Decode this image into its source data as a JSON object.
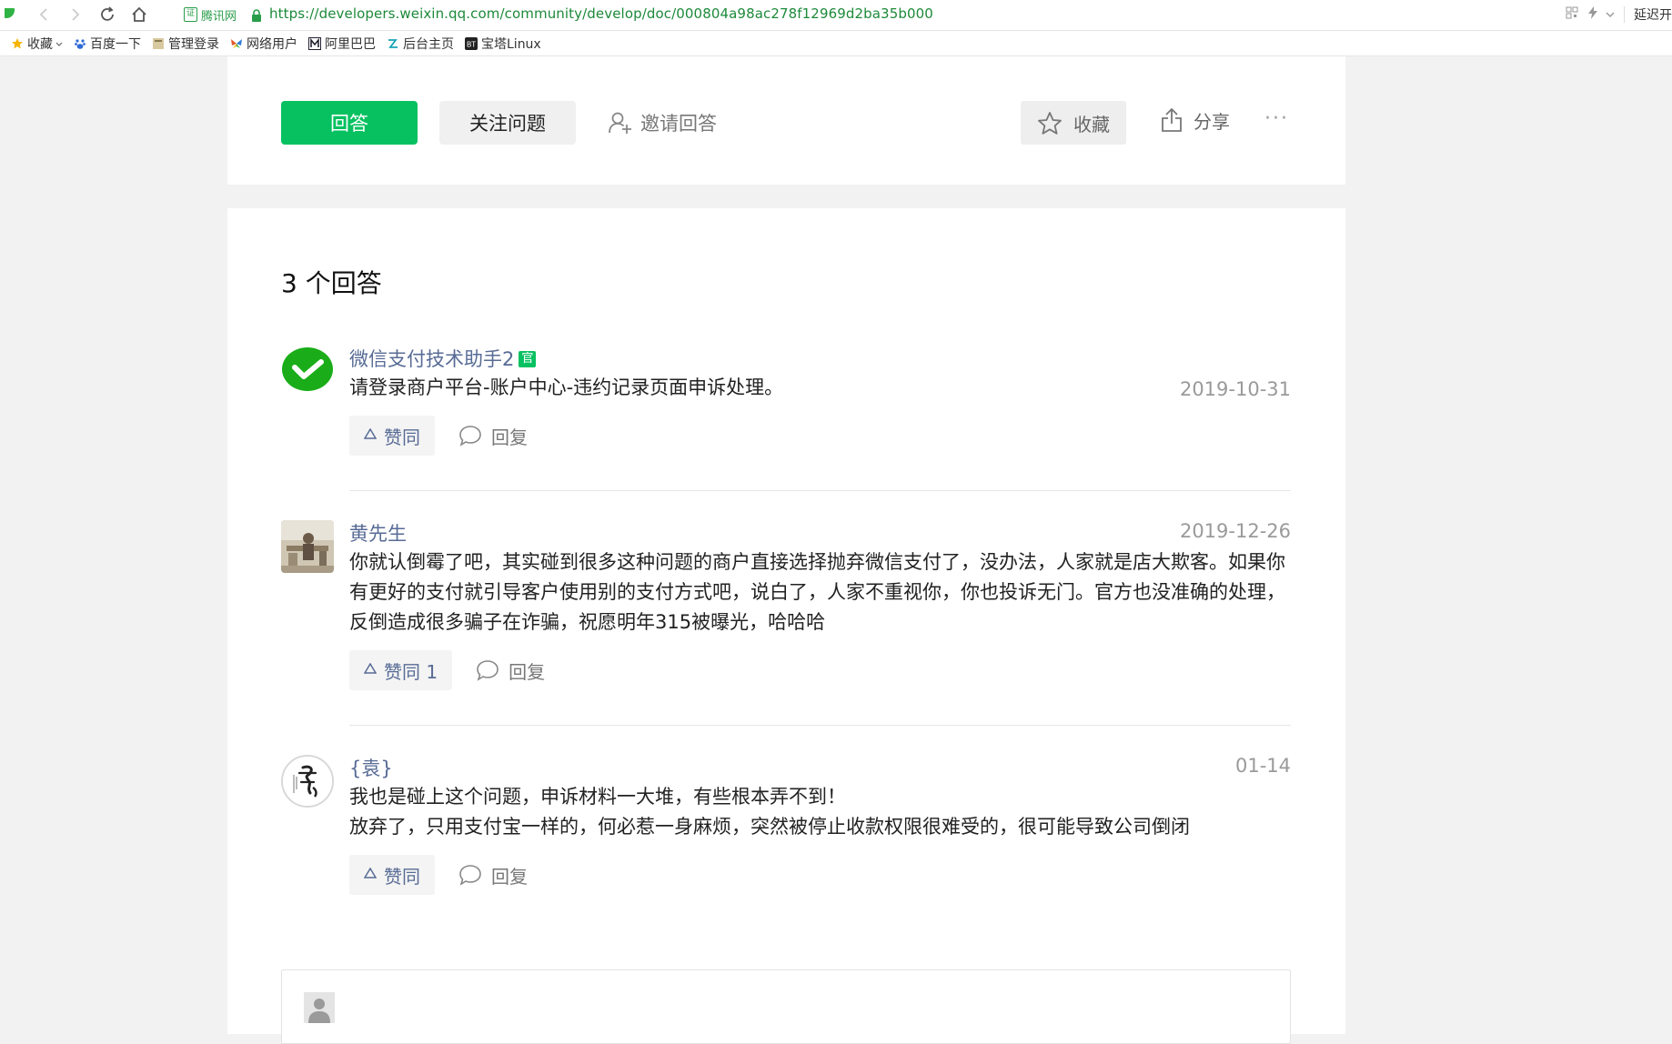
{
  "browser": {
    "site_badge": "腾讯网",
    "url": "https://developers.weixin.qq.com/community/develop/doc/000804a98ac278f12969d2ba35b000",
    "right_ext": "延迟开"
  },
  "bookmarks": [
    {
      "label": "收藏",
      "icon": "star-icon"
    },
    {
      "label": "百度一下",
      "icon": "baidu-paw-icon"
    },
    {
      "label": "管理登录",
      "icon": "page-icon"
    },
    {
      "label": "网络用户",
      "icon": "butterfly-icon"
    },
    {
      "label": "阿里巴巴",
      "icon": "m-logo-icon"
    },
    {
      "label": "后台主页",
      "icon": "arrow-logo-icon"
    },
    {
      "label": "宝塔Linux",
      "icon": "bt-logo-icon"
    }
  ],
  "toolbar": {
    "answer_label": "回答",
    "follow_label": "关注问题",
    "invite_label": "邀请回答",
    "collect_label": "收藏",
    "share_label": "分享",
    "more_label": "···"
  },
  "answers_title": "3 个回答",
  "answers": [
    {
      "author": "微信支付技术助手2",
      "badge": "官",
      "date": "2019-10-31",
      "text": "请登录商户平台-账户中心-违约记录页面申诉处理。",
      "like_label": "赞同",
      "reply_label": "回复"
    },
    {
      "author": "黄先生",
      "date": "2019-12-26",
      "text": "你就认倒霉了吧，其实碰到很多这种问题的商户直接选择抛弃微信支付了，没办法，人家就是店大欺客。如果你有更好的支付就引导客户使用别的支付方式吧，说白了，人家不重视你，你也投诉无门。官方也没准确的处理，反倒造成很多骗子在诈骗，祝愿明年315被曝光，哈哈哈",
      "like_label": "赞同 1",
      "reply_label": "回复"
    },
    {
      "author": "{袁}",
      "date": "01-14",
      "text_line1": "我也是碰上这个问题，申诉材料一大堆，有些根本弄不到！",
      "text_line2": "放弃了，只用支付宝一样的，何必惹一身麻烦，突然被停止收款权限很难受的，很可能导致公司倒闭",
      "like_label": "赞同",
      "reply_label": "回复"
    }
  ],
  "colors": {
    "brand_green": "#07c160",
    "link_blue": "#576b95",
    "date_gray": "#9a9a9a"
  }
}
